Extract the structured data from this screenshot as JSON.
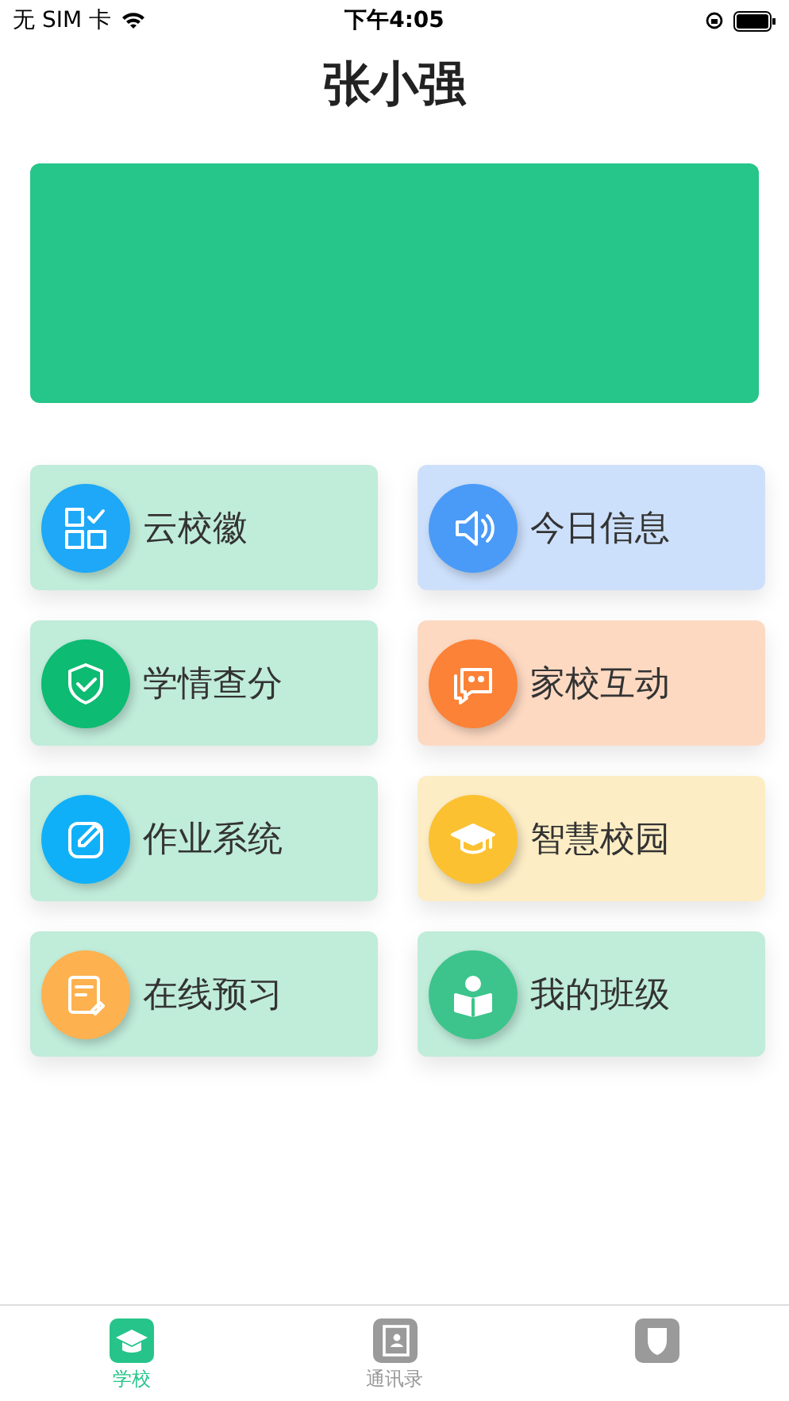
{
  "status_bar": {
    "carrier": "无 SIM 卡",
    "time": "下午4:05"
  },
  "title": "张小强",
  "tiles": [
    {
      "label": "云校徽",
      "color": "#1ea8f7",
      "card": {
        "color": "#c0ecda"
      }
    },
    {
      "label": "今日信息",
      "color": "#4a9bf8",
      "card": {
        "color": "#cde0fb"
      }
    },
    {
      "label": "学情查分",
      "color": "#0dbb72",
      "card": {
        "color": "#c0ecda"
      }
    },
    {
      "label": "家校互动",
      "color": "#fb8237",
      "card": {
        "color": "#fdd9c2"
      }
    },
    {
      "label": "作业系统",
      "color": "#10b0f8",
      "card": {
        "color": "#c0ecda"
      }
    },
    {
      "label": "智慧校园",
      "color": "#fbc131",
      "card": {
        "color": "#fdedc5"
      }
    },
    {
      "label": "在线预习",
      "color": "#feb14f",
      "card": {
        "color": "#c0ecda"
      }
    },
    {
      "label": "我的班级",
      "color": "#3cc48c",
      "card": {
        "color": "#c0ecda"
      }
    }
  ],
  "tab_bar": [
    {
      "label": "学校",
      "selected": true
    },
    {
      "label": "通讯录",
      "selected": false
    },
    {
      "selected": false
    }
  ]
}
